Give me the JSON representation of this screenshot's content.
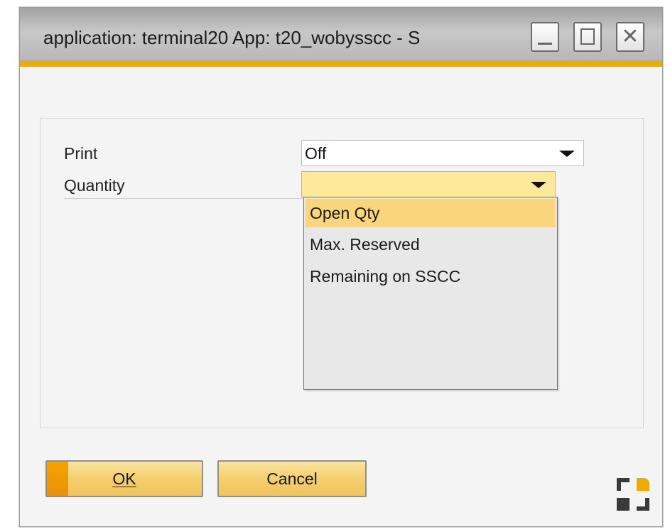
{
  "window": {
    "title": "application: terminal20 App: t20_wobysscc - S",
    "controls": {
      "minimize": "minimize-icon",
      "maximize": "maximize-icon",
      "close": "close-icon"
    }
  },
  "form": {
    "fields": [
      {
        "label": "Print",
        "value": "Off"
      },
      {
        "label": "Quantity",
        "value": ""
      }
    ],
    "dropdown": {
      "options": [
        "Open Qty",
        "Max. Reserved",
        "Remaining on SSCC"
      ],
      "highlighted": "Open Qty"
    }
  },
  "buttons": {
    "ok": "OK",
    "cancel": "Cancel"
  },
  "colors": {
    "accent": "#f0ab00",
    "highlight": "#f9d57c",
    "active_field": "#fde99a",
    "button": "#f4cf6d"
  },
  "logo": "sap-logo-icon"
}
